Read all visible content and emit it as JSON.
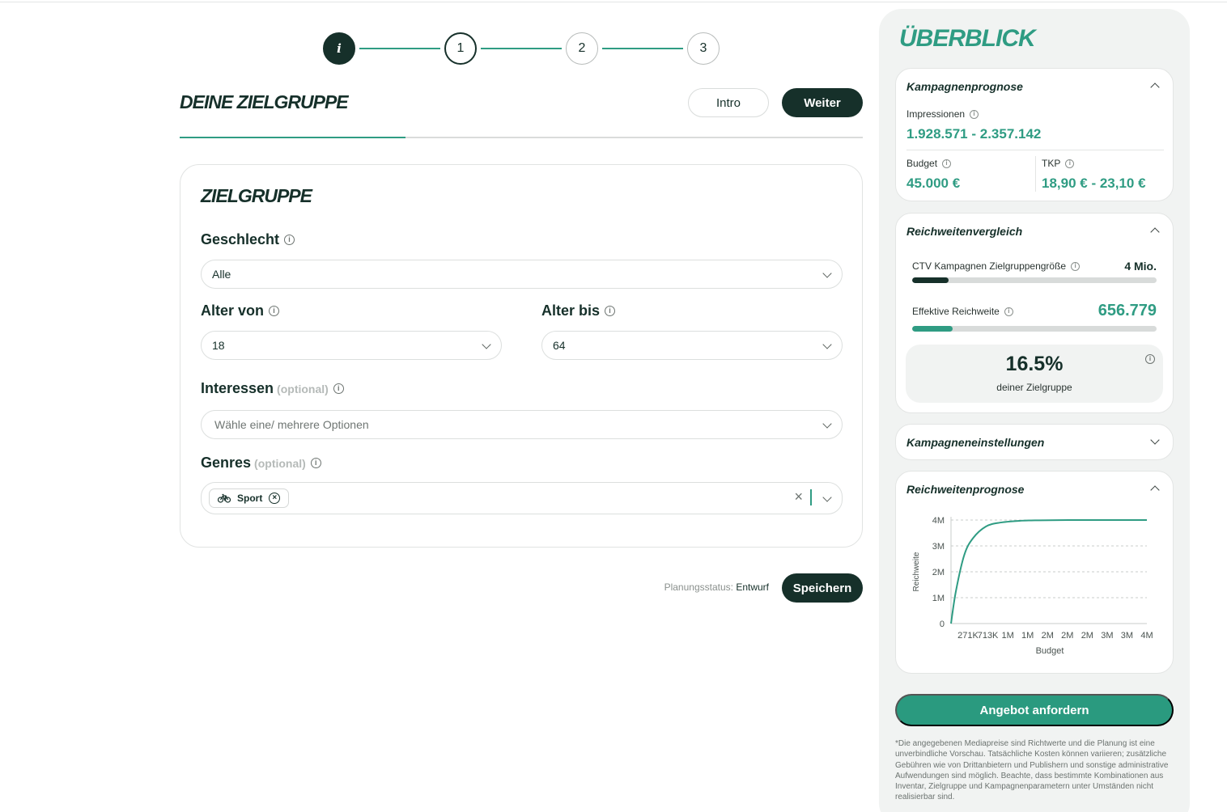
{
  "stepper": {
    "info_glyph": "i",
    "steps": [
      "1",
      "2",
      "3"
    ]
  },
  "header": {
    "title": "DEINE ZIELGRUPPE",
    "intro_label": "Intro",
    "next_label": "Weiter",
    "progress_fraction": 0.33
  },
  "form": {
    "title": "ZIELGRUPPE",
    "gender": {
      "label": "Geschlecht",
      "value": "Alle"
    },
    "age_from": {
      "label": "Alter von",
      "value": "18"
    },
    "age_to": {
      "label": "Alter bis",
      "value": "64"
    },
    "interests": {
      "label": "Interessen",
      "optional": "(optional)",
      "placeholder": "Wähle eine/ mehrere Optionen"
    },
    "genres": {
      "label": "Genres",
      "optional": "(optional)",
      "chips": [
        "Sport"
      ]
    }
  },
  "footer": {
    "status_label": "Planungsstatus:",
    "status_value": "Entwurf",
    "save_label": "Speichern"
  },
  "sidebar": {
    "title": "ÜBERBLICK",
    "forecast": {
      "title": "Kampagnenprognose",
      "impressions_label": "Impressionen",
      "impressions_value": "1.928.571 - 2.357.142",
      "budget_label": "Budget",
      "budget_value": "45.000 €",
      "tkp_label": "TKP",
      "tkp_value": "18,90 € - 23,10 €"
    },
    "reach_compare": {
      "title": "Reichweitenvergleich",
      "audience_label": "CTV Kampagnen Zielgruppengröße",
      "audience_value": "4 Mio.",
      "audience_fill": 0.15,
      "effective_label": "Effektive Reichweite",
      "effective_value": "656.779",
      "effective_fill": 0.165,
      "percent_value": "16.5%",
      "percent_sub": "deiner Zielgruppe"
    },
    "settings": {
      "title": "Kampagneneinstellungen"
    },
    "reach_forecast": {
      "title": "Reichweitenprognose"
    },
    "cta_label": "Angebot anfordern",
    "disclaimer": "*Die angegebenen Mediapreise sind Richtwerte und die Planung ist eine unverbindliche Vorschau. Tatsächliche Kosten können variieren; zusätzliche Gebühren wie von Drittanbietern und Publishern und sonstige administrative Aufwendungen sind möglich. Beachte, dass bestimmte Kombinationen aus Inventar, Zielgruppe und Kampagnenparametern unter Umständen nicht realisierbar sind."
  },
  "colors": {
    "accent": "#2f9c83",
    "dark": "#16302a",
    "track": "#d8dbda"
  },
  "chart_data": {
    "type": "line",
    "xlabel": "Budget",
    "ylabel": "Reichweite",
    "x_tick_labels": [
      "271K",
      "713K",
      "1M",
      "1M",
      "2M",
      "2M",
      "2M",
      "3M",
      "3M",
      "4M"
    ],
    "y_tick_labels": [
      "0",
      "1M",
      "2M",
      "3M",
      "4M"
    ],
    "y_ticks": [
      0,
      1000000,
      2000000,
      3000000,
      4000000
    ],
    "ylim": [
      0,
      4000000
    ],
    "xlim": [
      0,
      4000000
    ],
    "x": [
      0,
      100000,
      271000,
      450000,
      713000,
      1000000,
      1400000,
      1800000,
      2400000,
      3000000,
      4000000
    ],
    "y": [
      0,
      1250000,
      2650000,
      3300000,
      3750000,
      3900000,
      3970000,
      3990000,
      4000000,
      4000000,
      4000000
    ],
    "grid": true,
    "line_color": "#2f9c83"
  }
}
